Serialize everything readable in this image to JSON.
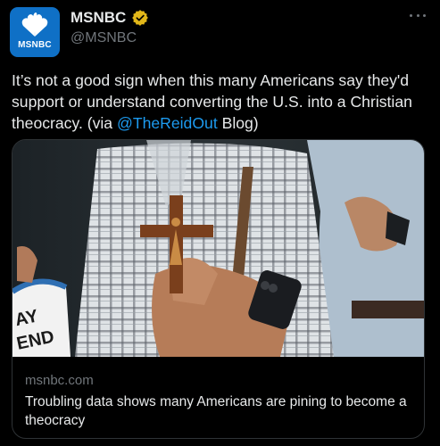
{
  "author": {
    "display_name": "MSNBC",
    "handle": "@MSNBC",
    "avatar_wordmark": "MSNBC",
    "verified": true,
    "verified_badge_color": "#e2b719"
  },
  "tweet": {
    "text_before": "It’s not a good sign when this many Americans say they'd support or understand converting the U.S. into a Christian theocracy. (via ",
    "mention": "@TheReidOut",
    "text_after": " Blog)"
  },
  "card": {
    "domain": "msnbc.com",
    "title": "Troubling data shows many Americans are pining to become a theocracy",
    "sign_text_lines": [
      "AY",
      "END"
    ]
  },
  "colors": {
    "background": "#000000",
    "text": "#e7e9ea",
    "secondary_text": "#71767b",
    "link": "#1d9bf0",
    "border": "#2f3336",
    "brand_blue": "#0f70c6"
  },
  "icons": {
    "avatar": "nbc-peacock-icon",
    "verified": "verified-badge-icon",
    "more": "more-horizontal-icon"
  }
}
